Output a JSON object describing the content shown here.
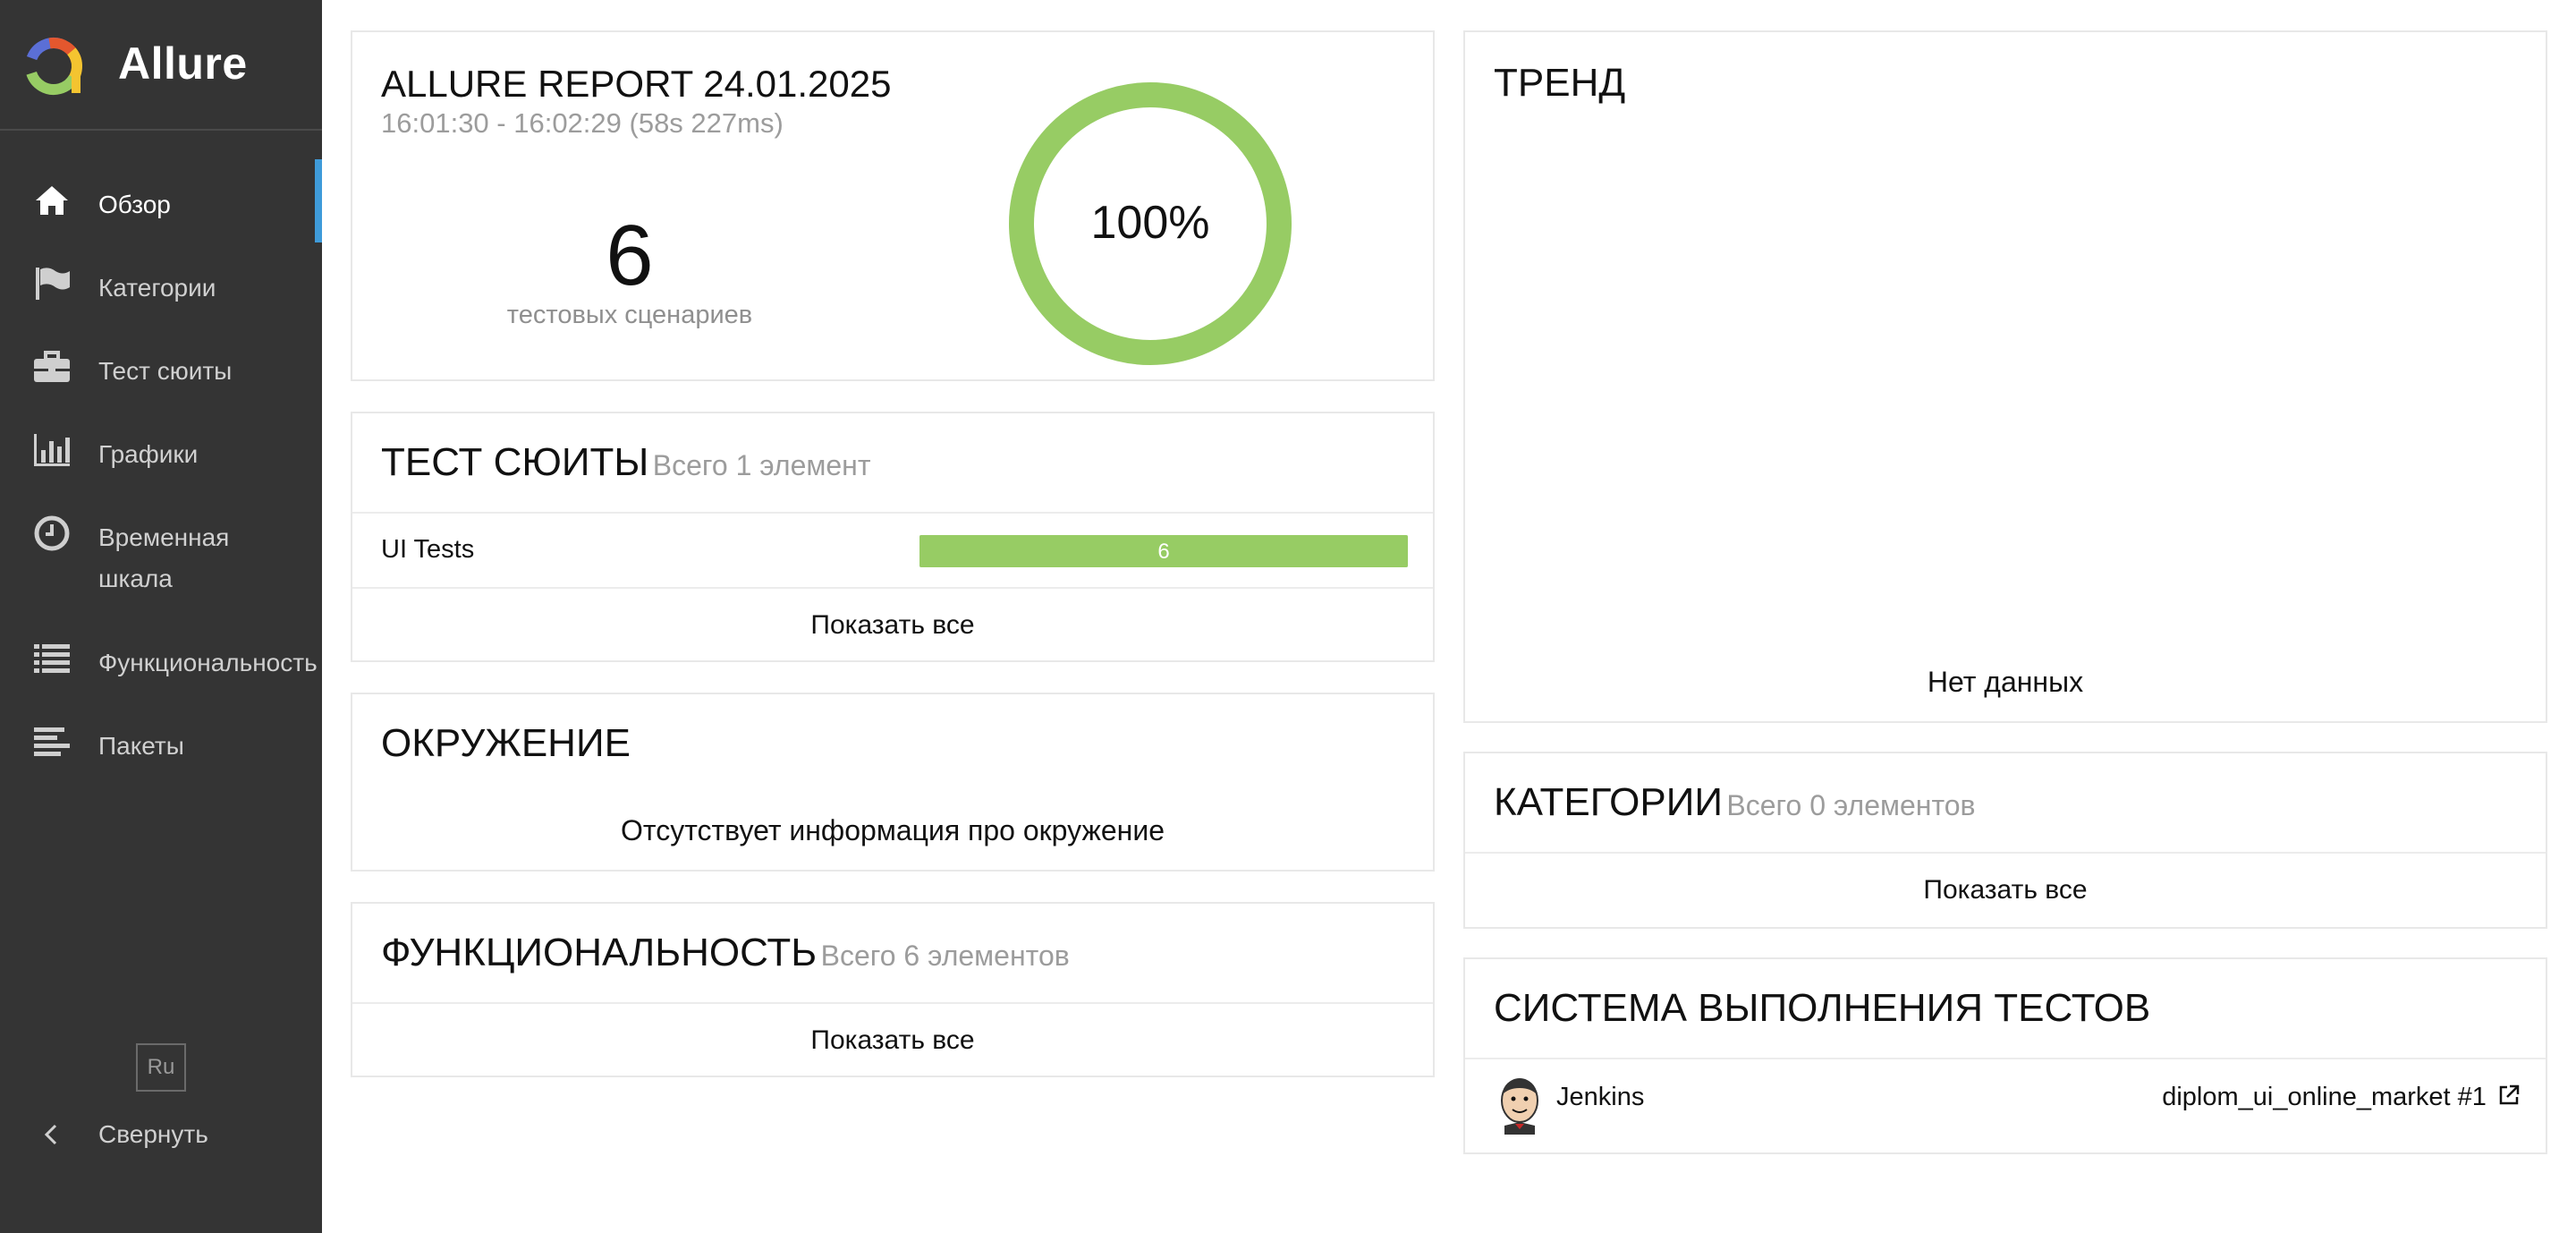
{
  "brand": {
    "name": "Allure"
  },
  "sidebar": {
    "items": [
      {
        "label": "Обзор",
        "icon": "home-icon",
        "active": true
      },
      {
        "label": "Категории",
        "icon": "flag-icon"
      },
      {
        "label": "Тест сюиты",
        "icon": "briefcase-icon"
      },
      {
        "label": "Графики",
        "icon": "bar-chart-icon"
      },
      {
        "label": "Временная шкала",
        "icon": "clock-icon"
      },
      {
        "label": "Функциональность",
        "icon": "list-icon"
      },
      {
        "label": "Пакеты",
        "icon": "align-left-icon"
      }
    ],
    "language": "Ru",
    "collapse_label": "Свернуть"
  },
  "summary": {
    "title": "ALLURE REPORT 24.01.2025",
    "time_range": "16:01:30 - 16:02:29 (58s 227ms)",
    "test_count": "6",
    "test_count_label": "тестовых сценариев",
    "pass_percent_label": "100%",
    "pass_fraction": 1.0,
    "ring_color": "#97cc64"
  },
  "suites": {
    "title": "ТЕСТ СЮИТЫ",
    "subtitle": "Всего 1 элемент",
    "rows": [
      {
        "name": "UI Tests",
        "count": "6",
        "passed_fraction": 1.0
      }
    ],
    "show_all": "Показать все"
  },
  "environment": {
    "title": "ОКРУЖЕНИЕ",
    "empty_text": "Отсутствует информация про окружение"
  },
  "features": {
    "title": "ФУНКЦИОНАЛЬНОСТЬ",
    "subtitle": "Всего 6 элементов",
    "show_all": "Показать все"
  },
  "trend": {
    "title": "ТРЕНД",
    "empty_text": "Нет данных"
  },
  "categories": {
    "title": "КАТЕГОРИИ",
    "subtitle": "Всего 0 элементов",
    "show_all": "Показать все"
  },
  "executors": {
    "title": "СИСТЕМА ВЫПОЛНЕНИЯ ТЕСТОВ",
    "name": "Jenkins",
    "build": "diplom_ui_online_market #1"
  },
  "colors": {
    "sidebar_bg": "#343434",
    "accent": "#3f9bd9",
    "passed": "#97cc64"
  }
}
